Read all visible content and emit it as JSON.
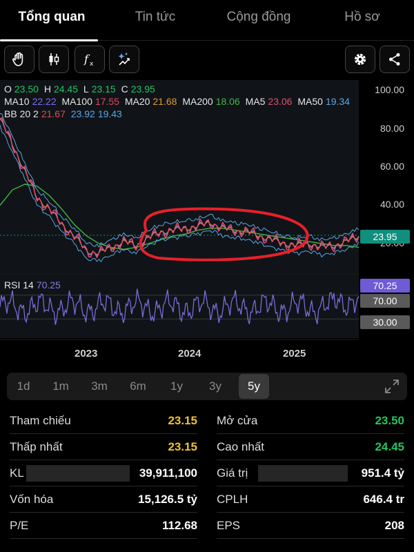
{
  "tabs": [
    "Tổng quan",
    "Tin tức",
    "Cộng đồng",
    "Hồ sơ"
  ],
  "toolbar": {
    "left_icons": [
      "hand-icon",
      "candlestick-icon",
      "function-icon",
      "ai-sparkle-icon"
    ],
    "right_icons": [
      "settings-icon",
      "share-icon"
    ]
  },
  "legend": {
    "ohlc": [
      {
        "label": "O",
        "value": "23.50"
      },
      {
        "label": "H",
        "value": "24.45"
      },
      {
        "label": "L",
        "value": "23.15"
      },
      {
        "label": "C",
        "value": "23.95"
      }
    ],
    "ma": [
      {
        "label": "MA10",
        "value": "22.22",
        "color": "#7b6cf6"
      },
      {
        "label": "MA100",
        "value": "17.55",
        "color": "#e0485a"
      },
      {
        "label": "MA20",
        "value": "21.68",
        "color": "#e39a2c"
      },
      {
        "label": "MA200",
        "value": "18.06",
        "color": "#3fb83f"
      },
      {
        "label": "MA5",
        "value": "23.06",
        "color": "#e54f6d"
      },
      {
        "label": "MA50",
        "value": "19.34",
        "color": "#5aa7e6"
      }
    ],
    "bb": {
      "label": "BB 20 2",
      "values": [
        "21.67",
        "23.92",
        "19.43"
      ],
      "colors": [
        "#e0485a",
        "#5aa7e6",
        "#5aa7e6"
      ]
    },
    "rsi": {
      "label": "RSI 14",
      "value": "70.25"
    }
  },
  "y_ticks": [
    "100.00",
    "80.00",
    "60.00",
    "40.00",
    "20.00"
  ],
  "x_ticks": [
    "2023",
    "2024",
    "2025"
  ],
  "badges": {
    "price": "23.95",
    "rsi": "70.25",
    "rsi_upper": "70.00",
    "rsi_lower": "30.00"
  },
  "colors": {
    "price_badge": "#0f8f7c",
    "rsi_badge": "#6e5bd6",
    "rsi_line": "#7b6cd9",
    "annotation": "#e8202a",
    "yellow": "#f2c12e",
    "green": "#22c55e"
  },
  "ranges": [
    "1d",
    "1m",
    "3m",
    "6m",
    "1y",
    "3y",
    "5y"
  ],
  "active_range": "5y",
  "stats": {
    "left": [
      {
        "label": "Tham chiếu",
        "value": "23.15",
        "color": "yellow"
      },
      {
        "label": "Thấp nhất",
        "value": "23.15",
        "color": "yellow"
      },
      {
        "label": "KL",
        "value": "39,911,100",
        "color": "white"
      },
      {
        "label": "Vốn hóa",
        "value": "15,126.5 tỷ",
        "color": "white"
      },
      {
        "label": "P/E",
        "value": "112.68",
        "color": "white"
      }
    ],
    "right": [
      {
        "label": "Mở cửa",
        "value": "23.50",
        "color": "green"
      },
      {
        "label": "Cao nhất",
        "value": "24.45",
        "color": "green"
      },
      {
        "label": "Giá trị",
        "value": "951.4 tỷ",
        "color": "white"
      },
      {
        "label": "CPLH",
        "value": "646.4 tr",
        "color": "white"
      },
      {
        "label": "EPS",
        "value": "208",
        "color": "white"
      }
    ]
  },
  "chart_data": {
    "type": "line",
    "x_ticks": [
      "2023",
      "2024",
      "2025"
    ],
    "ylim": [
      0,
      100
    ],
    "series": [
      {
        "name": "C",
        "values": [
          85,
          72,
          58,
          44,
          38,
          30,
          24,
          16,
          15,
          18,
          21,
          19,
          23,
          26,
          27,
          28,
          29,
          31,
          28,
          27,
          26,
          24,
          22,
          20,
          19,
          20,
          18,
          19,
          21,
          24
        ]
      },
      {
        "name": "MA200",
        "values": [
          40,
          48,
          51,
          50,
          45,
          38,
          30,
          24,
          20,
          18,
          17,
          18,
          20,
          22,
          24,
          25,
          27,
          28,
          28,
          27,
          26,
          25,
          24,
          23,
          22,
          21,
          20,
          19,
          19,
          18
        ]
      }
    ],
    "rsi": {
      "name": "RSI 14",
      "ylim": [
        0,
        100
      ],
      "levels": [
        70,
        30
      ]
    }
  }
}
